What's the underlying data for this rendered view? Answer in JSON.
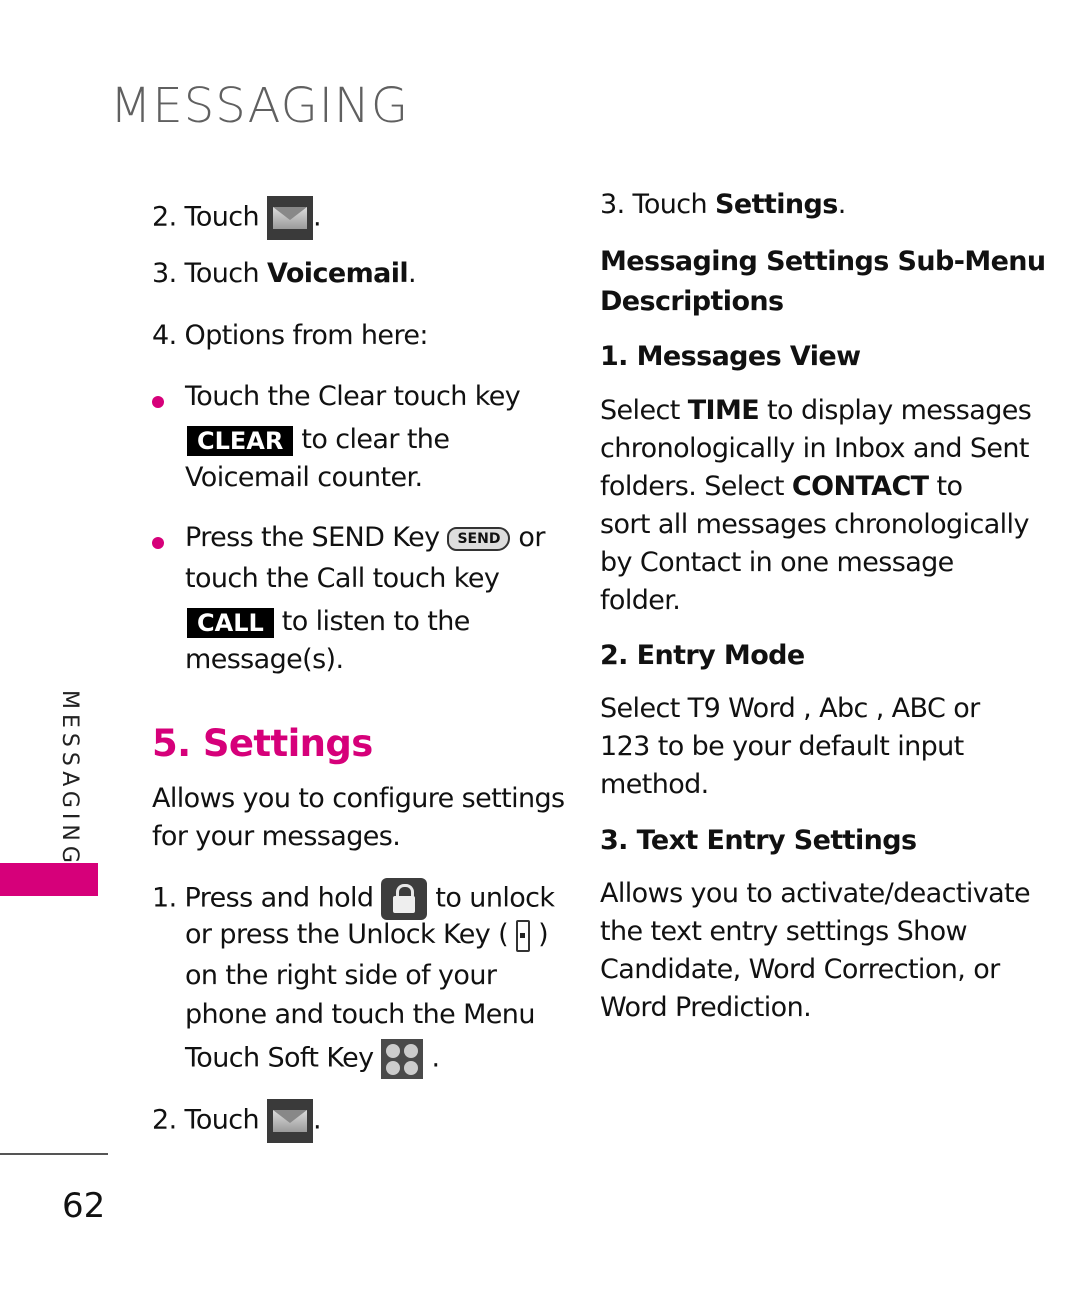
{
  "header": {
    "title": "MESSAGING"
  },
  "side_tab": {
    "label": "MESSAGING",
    "color": "#d6007a"
  },
  "page_number": "62",
  "left_column": {
    "step2_top": {
      "num": "2.",
      "text": "Touch",
      "icon": "messaging-envelope-icon",
      "end": "."
    },
    "step3_top": {
      "num": "3.",
      "text": "Touch",
      "bold": "Voicemail",
      "end": "."
    },
    "step4": {
      "num": "4.",
      "text": "Options from here:"
    },
    "bullet1": {
      "line1": "Touch the Clear touch key",
      "key": "CLEAR",
      "line2": "to clear the",
      "line3": "Voicemail counter."
    },
    "bullet2": {
      "line1a": "Press the SEND Key",
      "key_send": "SEND",
      "line1b": "or",
      "line2": "touch the Call touch key",
      "key": "CALL",
      "line3": "to listen to the",
      "line4": "message(s)."
    },
    "section": {
      "heading": "5. Settings",
      "desc1": "Allows you to configure settings",
      "desc2": "for your messages.",
      "step1": {
        "num": "1.",
        "l1a": "Press and hold",
        "l1b": "to unlock",
        "l2a": "or press the Unlock Key (",
        "l2b": ")",
        "l3": "on the right side of your",
        "l4": "phone and touch the Menu",
        "l5a": "Touch Soft Key",
        "l5b": "."
      },
      "step2": {
        "num": "2.",
        "text": "Touch",
        "end": "."
      }
    }
  },
  "right_column": {
    "step3": {
      "text": "3. Touch",
      "bold": "Settings",
      "end": "."
    },
    "submenu_heading": [
      "Messaging Settings Sub-Menu",
      "Descriptions"
    ],
    "items": [
      {
        "title": "1. Messages View",
        "lines": [
          "Select |TIME| to display messages",
          "chronologically in Inbox and Sent",
          "folders. Select |CONTACT| to",
          "sort all messages chronologically",
          "by Contact in one message",
          "folder."
        ]
      },
      {
        "title": "2. Entry Mode",
        "lines": [
          "Select T9 Word , Abc , ABC or",
          "123  to be your default input",
          "method."
        ]
      },
      {
        "title": "3. Text Entry Settings",
        "lines": [
          "Allows you to activate/deactivate",
          "the text entry settings Show",
          "Candidate, Word Correction, or",
          "Word Prediction."
        ]
      }
    ]
  }
}
